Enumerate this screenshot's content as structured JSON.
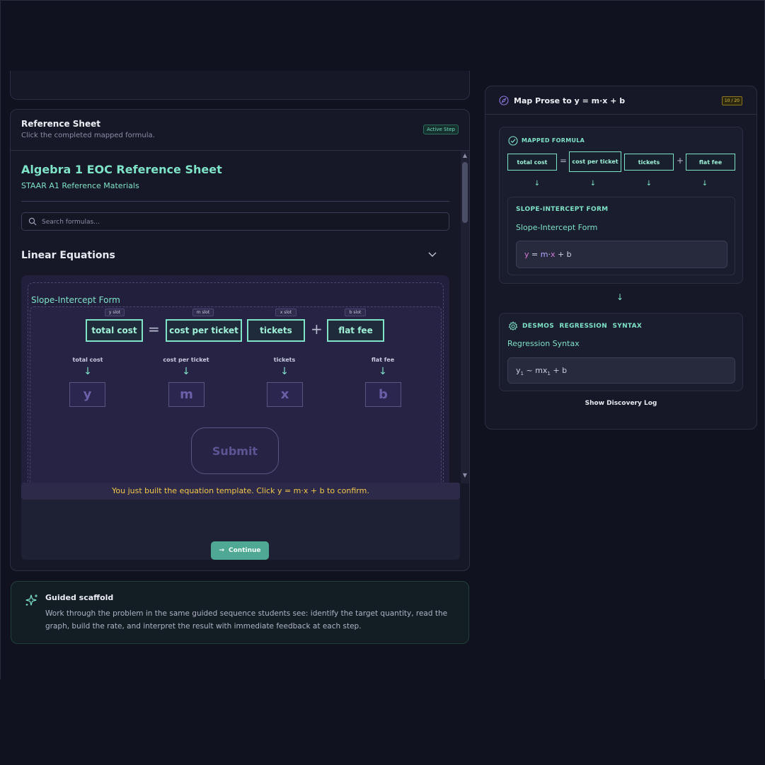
{
  "reference": {
    "title": "Reference Sheet",
    "subtitle": "Click the completed mapped formula.",
    "badge": "Active Step",
    "sheet_title": "Algebra 1 EOC Reference Sheet",
    "sheet_subtitle": "STAAR A1 Reference Materials",
    "search_placeholder": "Search formulas...",
    "section_title": "Linear Equations",
    "slope_label": "Slope-Intercept Form",
    "slots": [
      {
        "tag": "y slot",
        "token": "total cost",
        "label": "total cost",
        "var": "y"
      },
      {
        "tag": "m slot",
        "token": "cost per ticket",
        "label": "cost per ticket",
        "var": "m"
      },
      {
        "tag": "x slot",
        "token": "tickets",
        "label": "tickets",
        "var": "x"
      },
      {
        "tag": "b slot",
        "token": "flat fee",
        "label": "flat fee",
        "var": "b"
      }
    ],
    "eq_op": "=",
    "plus_op": "+",
    "arrow": "↓",
    "submit": "Submit",
    "hint": "You just built the equation template. Click y = m·x + b to confirm.",
    "continue": "Continue"
  },
  "scaffold": {
    "title": "Guided scaffold",
    "body": "Work through the problem in the same guided sequence students see: identify the target quantity, read the graph, build the rate, and interpret the result with immediate feedback at each step."
  },
  "map": {
    "title": "Map Prose to y = m·x + b",
    "count": "10 / 20",
    "mapped_title": "MAPPED FORMULA",
    "tokens": [
      "total cost",
      "cost per ticket",
      "tickets",
      "flat fee"
    ],
    "eq_op": "=",
    "plus_op": "+",
    "arrow": "↓",
    "slope_title": "SLOPE-INTERCEPT FORM",
    "slope_sub": "Slope-Intercept Form",
    "formula": {
      "y": "y",
      "eq": " = ",
      "m": "m",
      "dot": "·",
      "x": "x",
      "rest": " + b"
    },
    "desmos_title": "DESMOS REGRESSION SYNTAX",
    "desmos_sub": "Regression Syntax",
    "desmos_formula": {
      "a": "y",
      "sub1": "1",
      "b": " ~ mx",
      "sub2": "1",
      "c": " + b"
    },
    "discovery": "Show Discovery Log"
  },
  "colors": {
    "accent": "#7fe3c7",
    "hint": "#f2c84b",
    "background": "#11121f"
  }
}
